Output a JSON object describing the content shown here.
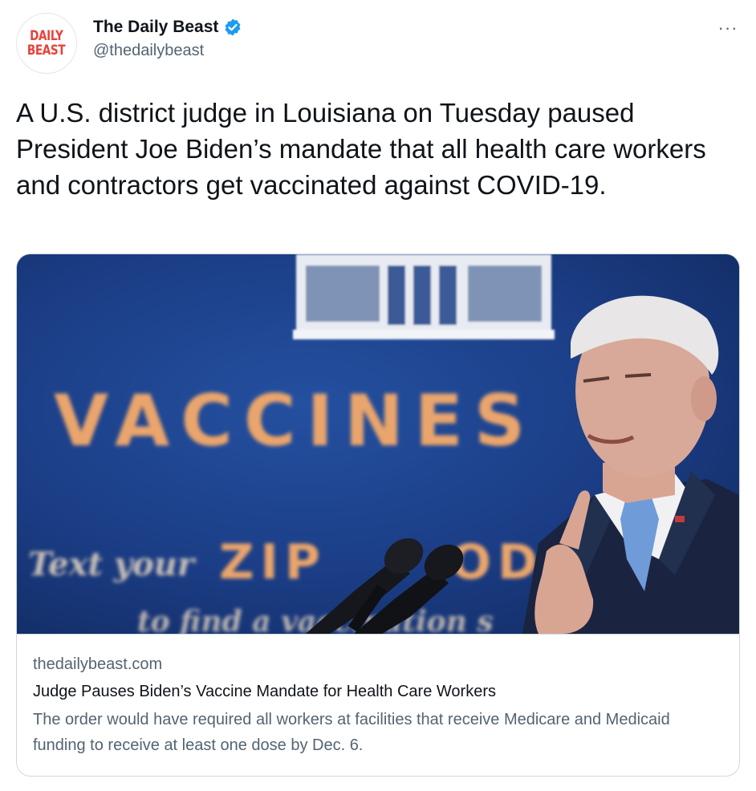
{
  "account": {
    "display_name": "The Daily Beast",
    "handle": "@thedailybeast",
    "avatar_lines": [
      "DAILY",
      "BEAST"
    ],
    "verified_icon": "verified-badge-icon",
    "verified_color": "#1d9bf0"
  },
  "menu": {
    "more_label": "···"
  },
  "tweet": {
    "text": "A U.S. district judge in Louisiana on Tuesday paused President Joe Biden’s mandate that all health care workers and contractors get vaccinated against COVID-19."
  },
  "card": {
    "image_sign_words": {
      "main": "VACCINES",
      "sub_prefix": "Text your",
      "sub_zip": "ZIP",
      "sub_tail": "ODE",
      "bottom": "to find a vaccination s"
    },
    "domain": "thedailybeast.com",
    "title": "Judge Pauses Biden’s Vaccine Mandate for Health Care Workers",
    "description": "The order would have required all workers at facilities that receive Medicare and Medicaid funding to receive at least one dose by Dec. 6."
  },
  "colors": {
    "text_primary": "#0f1419",
    "text_secondary": "#536471",
    "border": "#cfd9de",
    "brand_red": "#e8413a",
    "image_blue": "#1a3a7e",
    "sign_orange": "#e8a66b"
  }
}
